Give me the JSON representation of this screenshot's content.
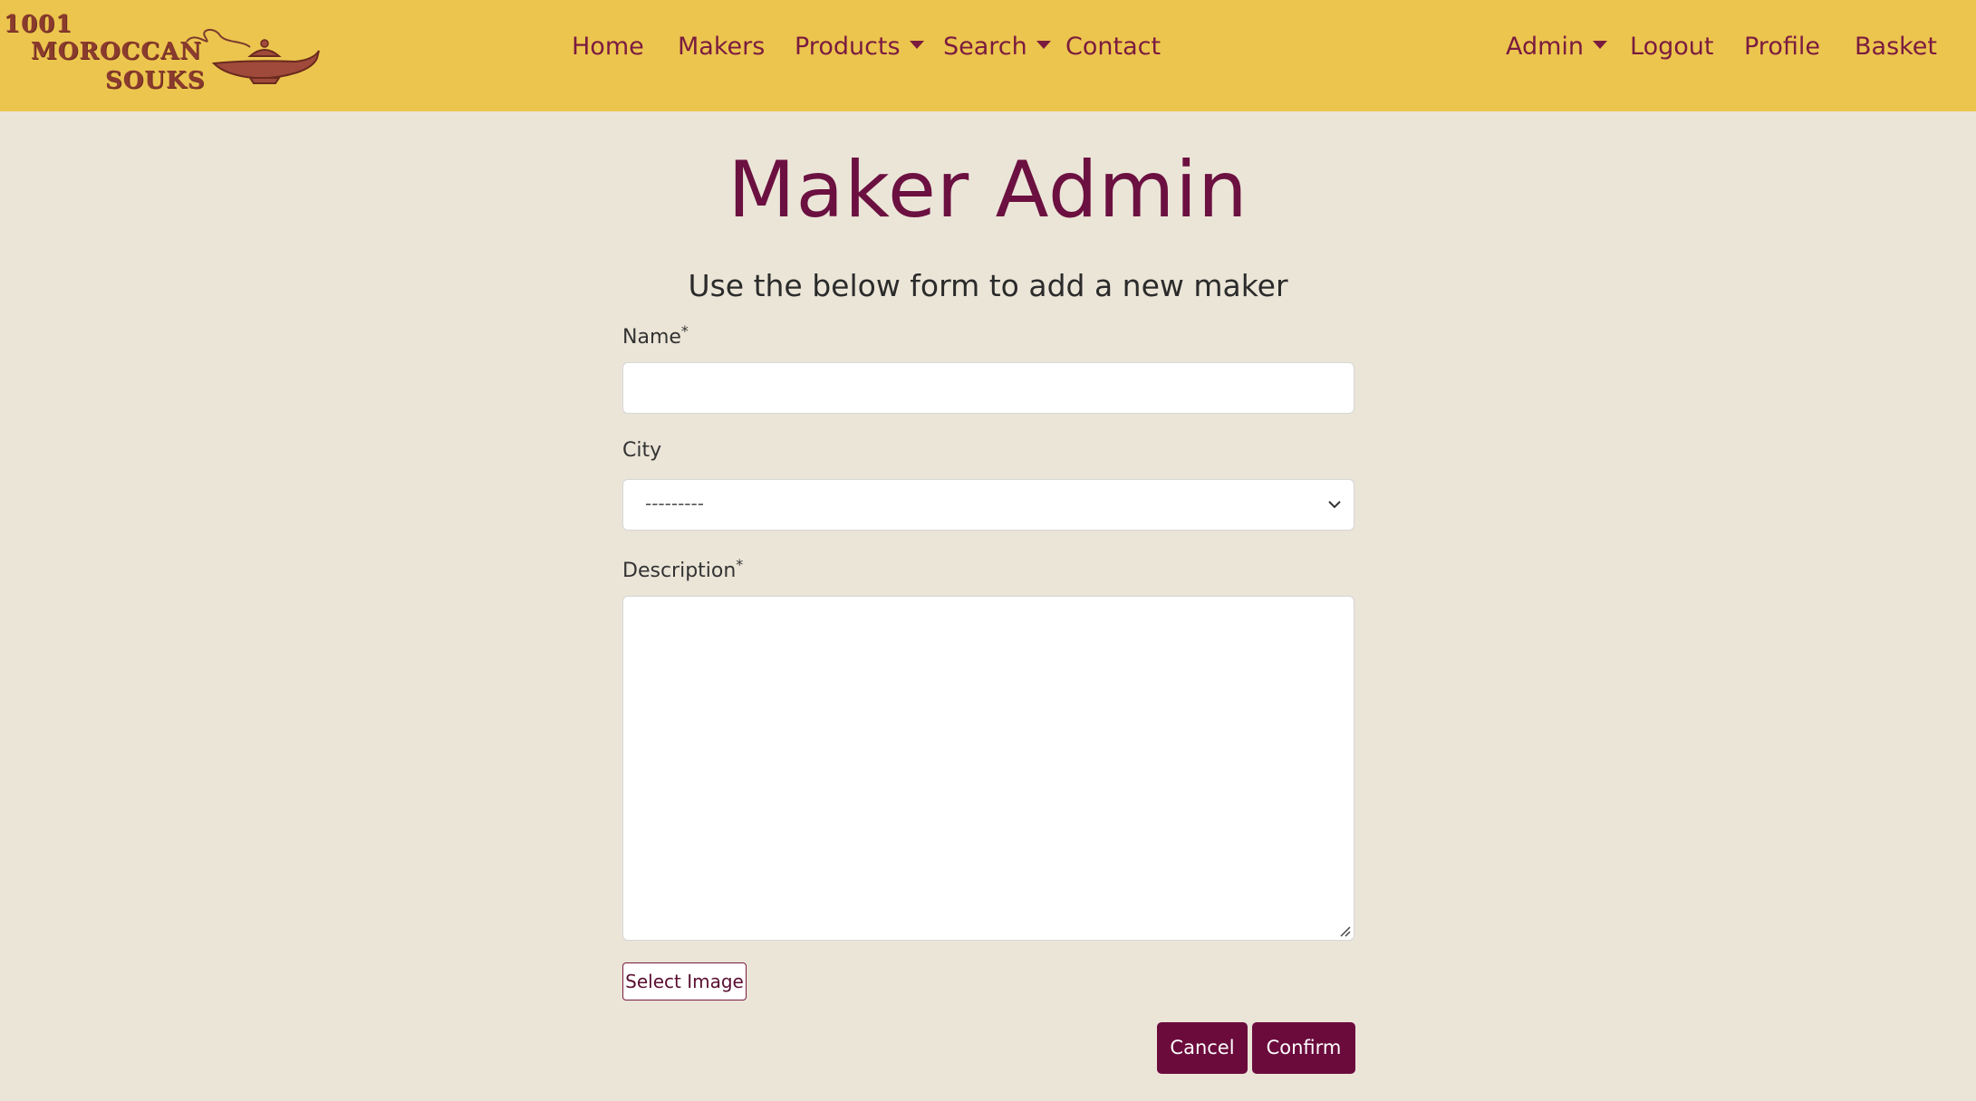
{
  "logo": {
    "line1": "1001",
    "line2": "MOROCCAN",
    "line3": "SOUKS",
    "icon": "lamp-icon"
  },
  "nav": {
    "home": "Home",
    "makers": "Makers",
    "products": "Products",
    "search": "Search",
    "contact": "Contact",
    "admin": "Admin",
    "logout": "Logout",
    "profile": "Profile",
    "basket": "Basket"
  },
  "page": {
    "title": "Maker Admin",
    "subtitle": "Use the below form to add a new maker"
  },
  "form": {
    "name_label": "Name",
    "name_value": "",
    "city_label": "City",
    "city_selected": "---------",
    "description_label": "Description",
    "description_value": "",
    "required_marker": "*",
    "select_image": "Select Image",
    "cancel": "Cancel",
    "confirm": "Confirm"
  },
  "colors": {
    "navbar": "#ecc54e",
    "background": "#ebe5d8",
    "accent": "#6b0b3c",
    "nav_text": "#7a1b3f"
  }
}
